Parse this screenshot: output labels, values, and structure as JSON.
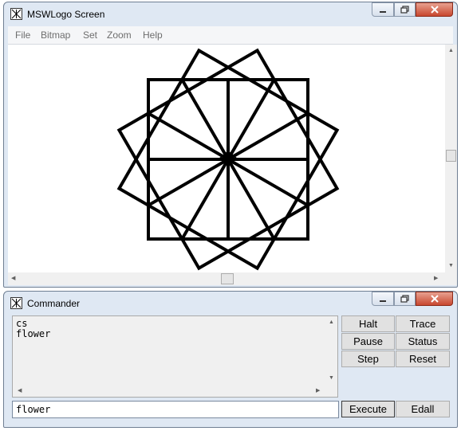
{
  "screen_window": {
    "title": "MSWLogo Screen",
    "menu": [
      "File",
      "Bitmap",
      "Set",
      "Zoom",
      "Help"
    ]
  },
  "commander_window": {
    "title": "Commander",
    "history": "cs\nflower",
    "input_value": "flower",
    "buttons": {
      "halt": "Halt",
      "trace": "Trace",
      "pause": "Pause",
      "status": "Status",
      "step": "Step",
      "reset": "Reset",
      "execute": "Execute",
      "edall": "Edall"
    }
  },
  "drawing": {
    "description_free": true,
    "stroke_color": "#000000",
    "squares": 3,
    "petal_lines": 12
  },
  "colors": {
    "frame": "#dfe8f3",
    "close_button": "#c8472f"
  }
}
